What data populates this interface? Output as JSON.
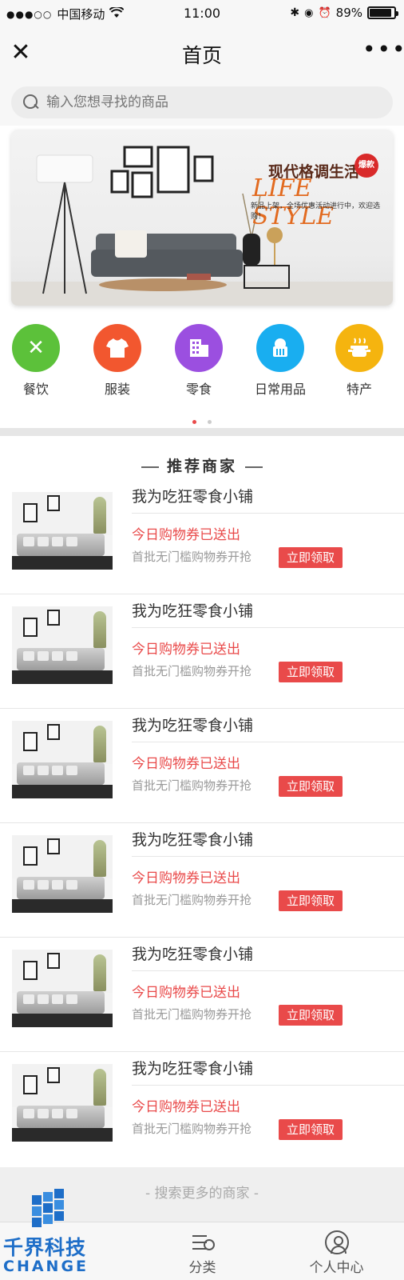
{
  "status_bar": {
    "carrier": "中国移动",
    "time": "11:00",
    "battery_text": "89%",
    "battery_level": 0.89
  },
  "nav": {
    "close_glyph": "✕",
    "title": "首页",
    "more_glyph": "•••"
  },
  "search": {
    "placeholder": "输入您想寻找的商品"
  },
  "banner": {
    "title_cn": "现代格调生活",
    "title_en": "LIFE STYLE",
    "subtitle": "新品上架，全场优惠活动进行中，欢迎选购！",
    "badge": "爆款"
  },
  "categories": [
    {
      "label": "餐饮",
      "icon": "fork-knife-icon",
      "glyph": "✕",
      "color": "#5cc13a"
    },
    {
      "label": "服装",
      "icon": "shirt-icon",
      "glyph": "👕",
      "color": "#f2572f"
    },
    {
      "label": "零食",
      "icon": "building-icon",
      "glyph": "▦",
      "color": "#9b4fe0"
    },
    {
      "label": "日常用品",
      "icon": "basket-icon",
      "glyph": "♛",
      "color": "#19aef0"
    },
    {
      "label": "特产",
      "icon": "pot-icon",
      "glyph": "♨",
      "color": "#f5b40f"
    }
  ],
  "section": {
    "title": "推荐商家"
  },
  "merchants": [
    {
      "name": "我为吃狂零食小铺",
      "promo": "今日购物券已送出",
      "desc": "首批无门槛购物券开抢",
      "button": "立即领取"
    },
    {
      "name": "我为吃狂零食小铺",
      "promo": "今日购物券已送出",
      "desc": "首批无门槛购物券开抢",
      "button": "立即领取"
    },
    {
      "name": "我为吃狂零食小铺",
      "promo": "今日购物券已送出",
      "desc": "首批无门槛购物券开抢",
      "button": "立即领取"
    },
    {
      "name": "我为吃狂零食小铺",
      "promo": "今日购物券已送出",
      "desc": "首批无门槛购物券开抢",
      "button": "立即领取"
    },
    {
      "name": "我为吃狂零食小铺",
      "promo": "今日购物券已送出",
      "desc": "首批无门槛购物券开抢",
      "button": "立即领取"
    },
    {
      "name": "我为吃狂零食小铺",
      "promo": "今日购物券已送出",
      "desc": "首批无门槛购物券开抢",
      "button": "立即领取"
    }
  ],
  "search_more": "- 搜索更多的商家 -",
  "tabs": [
    {
      "label": "分类",
      "icon": "list-search-icon"
    },
    {
      "label": "个人中心",
      "icon": "user-icon"
    }
  ],
  "watermark": {
    "text": "千界科技",
    "sub": "CHANGE"
  },
  "colors": {
    "accent": "#e94a4a",
    "watermark": "#1e6ec8"
  }
}
